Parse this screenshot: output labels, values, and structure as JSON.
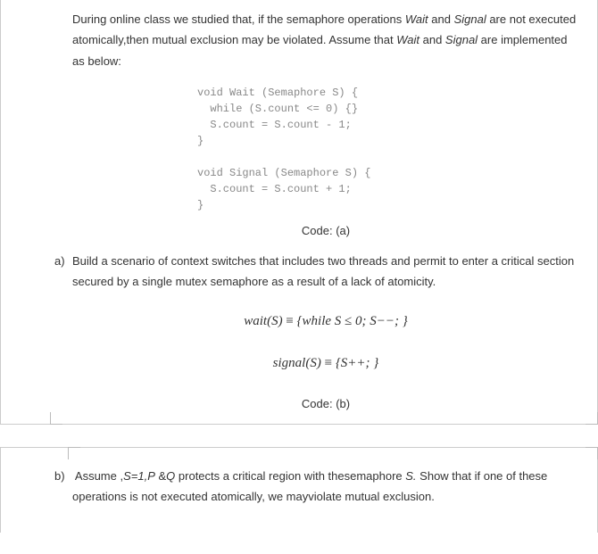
{
  "intro": {
    "p1a": "During online class we studied that, if the semaphore operations ",
    "wait1": "Wait",
    "p1b": " and ",
    "signal1": "Signal",
    "p1c": " are not executed atomically,then mutual exclusion may be violated. Assume that ",
    "wait2": "Wait",
    "p1d": " and ",
    "signal2": "Signal",
    "p1e": " are implemented as below:"
  },
  "code_a": {
    "l1": "void Wait (Semaphore S) {",
    "l2": "  while (S.count <= 0) {}",
    "l3": "  S.count = S.count - 1;",
    "l4": "}",
    "l5": "",
    "l6": "void Signal (Semaphore S) {",
    "l7": "  S.count = S.count + 1;",
    "l8": "}"
  },
  "caption_a": "Code: (a)",
  "q_a": {
    "label": "a)",
    "text": "Build a scenario of context switches that includes two threads and permit to enter a critical section secured by a single mutex semaphore as a result of a lack of atomicity."
  },
  "math": {
    "wait_lhs": "wait(S) ",
    "eq": "≡",
    "wait_rhs": " {while S ≤ 0; S−−; }",
    "signal_lhs": "signal(S) ",
    "signal_rhs": " {S++; }"
  },
  "caption_b": "Code: (b)",
  "q_b": {
    "label": "b)",
    "prefix": "Assume ,",
    "svar": "S=1,P",
    "amp": " &",
    "qvar": "Q",
    "mid": " protects a critical region with thesemaphore ",
    "svar2": "S.",
    "suffix": " Show that if one of these operations is not executed atomically, we mayviolate mutual exclusion."
  }
}
